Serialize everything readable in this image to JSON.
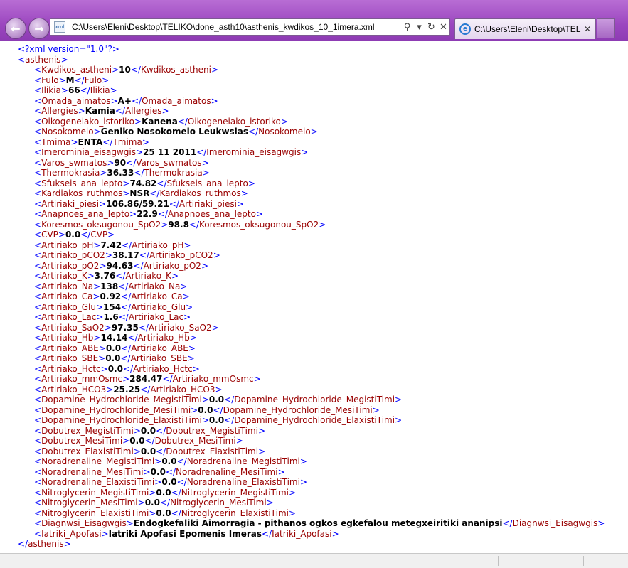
{
  "browser": {
    "address": "C:\\Users\\Eleni\\Desktop\\TELIKO\\done_asth10\\asthenis_kwdikos_10_1imera.xml",
    "tab_title": "C:\\Users\\Eleni\\Desktop\\TEL...",
    "icons": {
      "back": "back-arrow-icon",
      "forward": "forward-arrow-icon",
      "search": "search-icon",
      "dropdown": "chevron-down-icon",
      "refresh": "refresh-icon",
      "stop": "close-icon",
      "tab_favicon": "ie-icon"
    }
  },
  "xml": {
    "declaration": "<?xml version=\"1.0\"?>",
    "root_tag": "asthenis",
    "collapse_symbol": "-",
    "elements": [
      {
        "tag": "Kwdikos_astheni",
        "value": "10"
      },
      {
        "tag": "Fulo",
        "value": "M"
      },
      {
        "tag": "Ilikia",
        "value": "66"
      },
      {
        "tag": "Omada_aimatos",
        "value": "A+"
      },
      {
        "tag": "Allergies",
        "value": "Kamia"
      },
      {
        "tag": "Oikogeneiako_istoriko",
        "value": "Kanena"
      },
      {
        "tag": "Nosokomeio",
        "value": "Geniko Nosokomeio Leukwsias"
      },
      {
        "tag": "Tmima",
        "value": "ENTA"
      },
      {
        "tag": "Imerominia_eisagwgis",
        "value": "25 11 2011"
      },
      {
        "tag": "Varos_swmatos",
        "value": "90"
      },
      {
        "tag": "Thermokrasia",
        "value": "36.33"
      },
      {
        "tag": "Sfukseis_ana_lepto",
        "value": "74.82"
      },
      {
        "tag": "Kardiakos_ruthmos",
        "value": "NSR"
      },
      {
        "tag": "Artiriaki_piesi",
        "value": "106.86/59.21"
      },
      {
        "tag": "Anapnoes_ana_lepto",
        "value": "22.9"
      },
      {
        "tag": "Koresmos_oksugonou_SpO2",
        "value": "98.8"
      },
      {
        "tag": "CVP",
        "value": "0.0"
      },
      {
        "tag": "Artiriako_pH",
        "value": "7.42"
      },
      {
        "tag": "Artiriako_pCO2",
        "value": "38.17"
      },
      {
        "tag": "Artiriako_pO2",
        "value": "94.63"
      },
      {
        "tag": "Artiriako_K",
        "value": "3.76"
      },
      {
        "tag": "Artiriako_Na",
        "value": "138"
      },
      {
        "tag": "Artiriako_Ca",
        "value": "0.92"
      },
      {
        "tag": "Artiriako_Glu",
        "value": "154"
      },
      {
        "tag": "Artiriako_Lac",
        "value": "1.6"
      },
      {
        "tag": "Artiriako_SaO2",
        "value": "97.35"
      },
      {
        "tag": "Artiriako_Hb",
        "value": "14.14"
      },
      {
        "tag": "Artiriako_ABE",
        "value": "0.0"
      },
      {
        "tag": "Artiriako_SBE",
        "value": "0.0"
      },
      {
        "tag": "Artiriako_Hctc",
        "value": "0.0"
      },
      {
        "tag": "Artiriako_mmOsmc",
        "value": "284.47"
      },
      {
        "tag": "Artiriako_HCO3",
        "value": "25.25"
      },
      {
        "tag": "Dopamine_Hydrochloride_MegistiTimi",
        "value": "0.0"
      },
      {
        "tag": "Dopamine_Hydrochloride_MesiTimi",
        "value": "0.0"
      },
      {
        "tag": "Dopamine_Hydrochloride_ElaxistiTimi",
        "value": "0.0"
      },
      {
        "tag": "Dobutrex_MegistiTimi",
        "value": "0.0"
      },
      {
        "tag": "Dobutrex_MesiTimi",
        "value": "0.0"
      },
      {
        "tag": "Dobutrex_ElaxistiTimi",
        "value": "0.0"
      },
      {
        "tag": "Noradrenaline_MegistiTimi",
        "value": "0.0"
      },
      {
        "tag": "Noradrenaline_MesiTimi",
        "value": "0.0"
      },
      {
        "tag": "Noradrenaline_ElaxistiTimi",
        "value": "0.0"
      },
      {
        "tag": "Nitroglycerin_MegistiTimi",
        "value": "0.0"
      },
      {
        "tag": "Nitroglycerin_MesiTimi",
        "value": "0.0"
      },
      {
        "tag": "Nitroglycerin_ElaxistiTimi",
        "value": "0.0"
      },
      {
        "tag": "Diagnwsi_Eisagwgis",
        "value": "Endogkefaliki Aimorragia - pithanos ogkos egkefalou metegxeiritiki ananipsi"
      },
      {
        "tag": "Iatriki_Apofasi",
        "value": "Iatriki Apofasi Epomenis Imeras"
      }
    ]
  }
}
